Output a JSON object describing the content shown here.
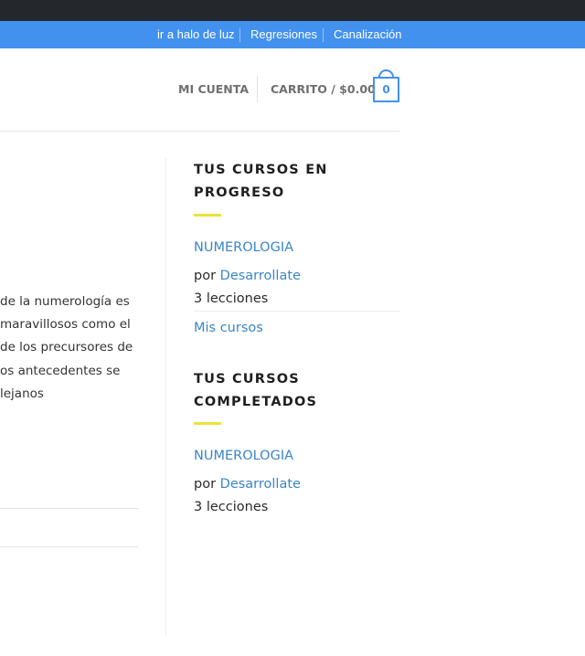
{
  "topnav": {
    "links": [
      "ir a halo de luz",
      "Regresiones",
      "Canalización"
    ]
  },
  "header": {
    "account_label": "MI CUENTA",
    "cart_label": "CARRITO / $0.00",
    "cart_count": "0"
  },
  "article": {
    "lines": [
      "de la numerología es",
      "maravillosos como el",
      "de los precursores de",
      "os antecedentes se",
      "lejanos"
    ]
  },
  "sidebar": {
    "in_progress": {
      "title_line1": "TUS CURSOS EN",
      "title_line2": "PROGRESO",
      "course": "NUMEROLOGIA",
      "by_prefix": "por",
      "author": "Desarrollate",
      "lessons": "3 lecciones",
      "my_courses_link": "Mis cursos"
    },
    "completed": {
      "title_line1": "TUS CURSOS",
      "title_line2": "COMPLETADOS",
      "course": "NUMEROLOGIA",
      "by_prefix": "por",
      "author": "Desarrollate",
      "lessons": "3 lecciones"
    }
  },
  "colors": {
    "topbar": "#24282d",
    "navbar": "#4391ef",
    "accent_yellow": "#e8e33c",
    "link": "#3a86c8"
  }
}
